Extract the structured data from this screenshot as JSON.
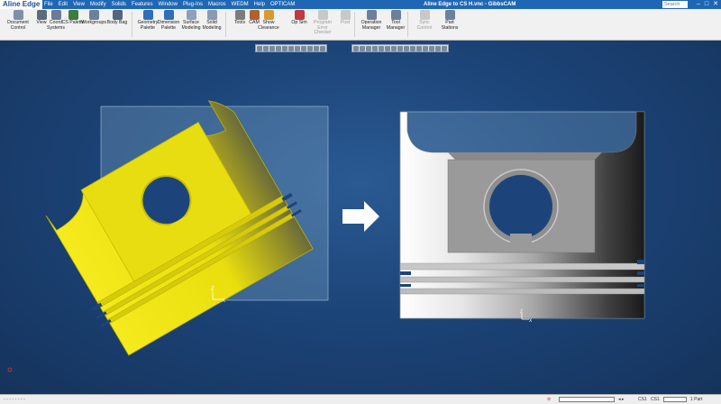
{
  "titlebar": {
    "doc_title": "Aline Edge",
    "window_title": "Aline Edge to CS H.vnc - GibbsCAM",
    "search_placeholder": "Search",
    "menus": [
      "File",
      "Edit",
      "View",
      "Modify",
      "Solids",
      "Features",
      "Window",
      "Plug-Ins",
      "Macros",
      "WEDM",
      "Help",
      "OPTICAM"
    ]
  },
  "ribbon": {
    "buttons": [
      {
        "label": "Document Control",
        "icon": "document-control-icon",
        "color": "#7f8fa6",
        "enabled": true
      },
      {
        "label": "View",
        "icon": "view-icon",
        "color": "#5c6a7e",
        "enabled": true
      },
      {
        "label": "Coord Systems",
        "icon": "coord-systems-icon",
        "color": "#6b7b93",
        "enabled": true
      },
      {
        "label": "CS Palette",
        "icon": "cs-palette-icon",
        "color": "#3f7a3f",
        "enabled": true
      },
      {
        "label": "Workgroups",
        "icon": "workgroups-icon",
        "color": "#6e7f99",
        "enabled": true
      },
      {
        "label": "Body Bag",
        "icon": "body-bag-icon",
        "color": "#54657d",
        "enabled": true
      },
      {
        "label": "Geometry Palette",
        "icon": "geometry-palette-icon",
        "color": "#2f6fb4",
        "enabled": true
      },
      {
        "label": "Dimension Palette",
        "icon": "dimension-palette-icon",
        "color": "#2f6fb4",
        "enabled": true
      },
      {
        "label": "Surface Modeling",
        "icon": "surface-modeling-icon",
        "color": "#8fa0b8",
        "enabled": true
      },
      {
        "label": "Solid Modeling",
        "icon": "solid-modeling-icon",
        "color": "#8a9ab0",
        "enabled": true
      },
      {
        "label": "Tools",
        "icon": "tools-icon",
        "color": "#7d7d7d",
        "enabled": true
      },
      {
        "label": "CAM",
        "icon": "cam-icon",
        "color": "#b0612f",
        "enabled": true
      },
      {
        "label": "Show Clearance",
        "icon": "show-clearance-icon",
        "color": "#d89a2e",
        "enabled": true
      },
      {
        "label": "Op Sim",
        "icon": "op-sim-icon",
        "color": "#c23a3a",
        "enabled": true
      },
      {
        "label": "Program Error Checker",
        "icon": "program-error-checker-icon",
        "color": "#c8c8c8",
        "enabled": false
      },
      {
        "label": "Post",
        "icon": "post-icon",
        "color": "#c8c8c8",
        "enabled": false
      },
      {
        "label": "Operation Manager",
        "icon": "operation-manager-icon",
        "color": "#6e7f99",
        "enabled": true
      },
      {
        "label": "Tool Manager",
        "icon": "tool-manager-icon",
        "color": "#6e7f99",
        "enabled": true
      },
      {
        "label": "Sync Control",
        "icon": "sync-control-icon",
        "color": "#c8c8c8",
        "enabled": false
      },
      {
        "label": "Part Stations",
        "icon": "part-stations-icon",
        "color": "#6e7f99",
        "enabled": true
      }
    ]
  },
  "viewport": {
    "axis_z": "Z",
    "axis_x": "X",
    "left_part_color": "#f2e600",
    "arrow_color": "#ffffff"
  },
  "statusbar": {
    "zoom_indicator": "CS1",
    "view_indicator": "CS1",
    "part_label": "1 Part"
  }
}
